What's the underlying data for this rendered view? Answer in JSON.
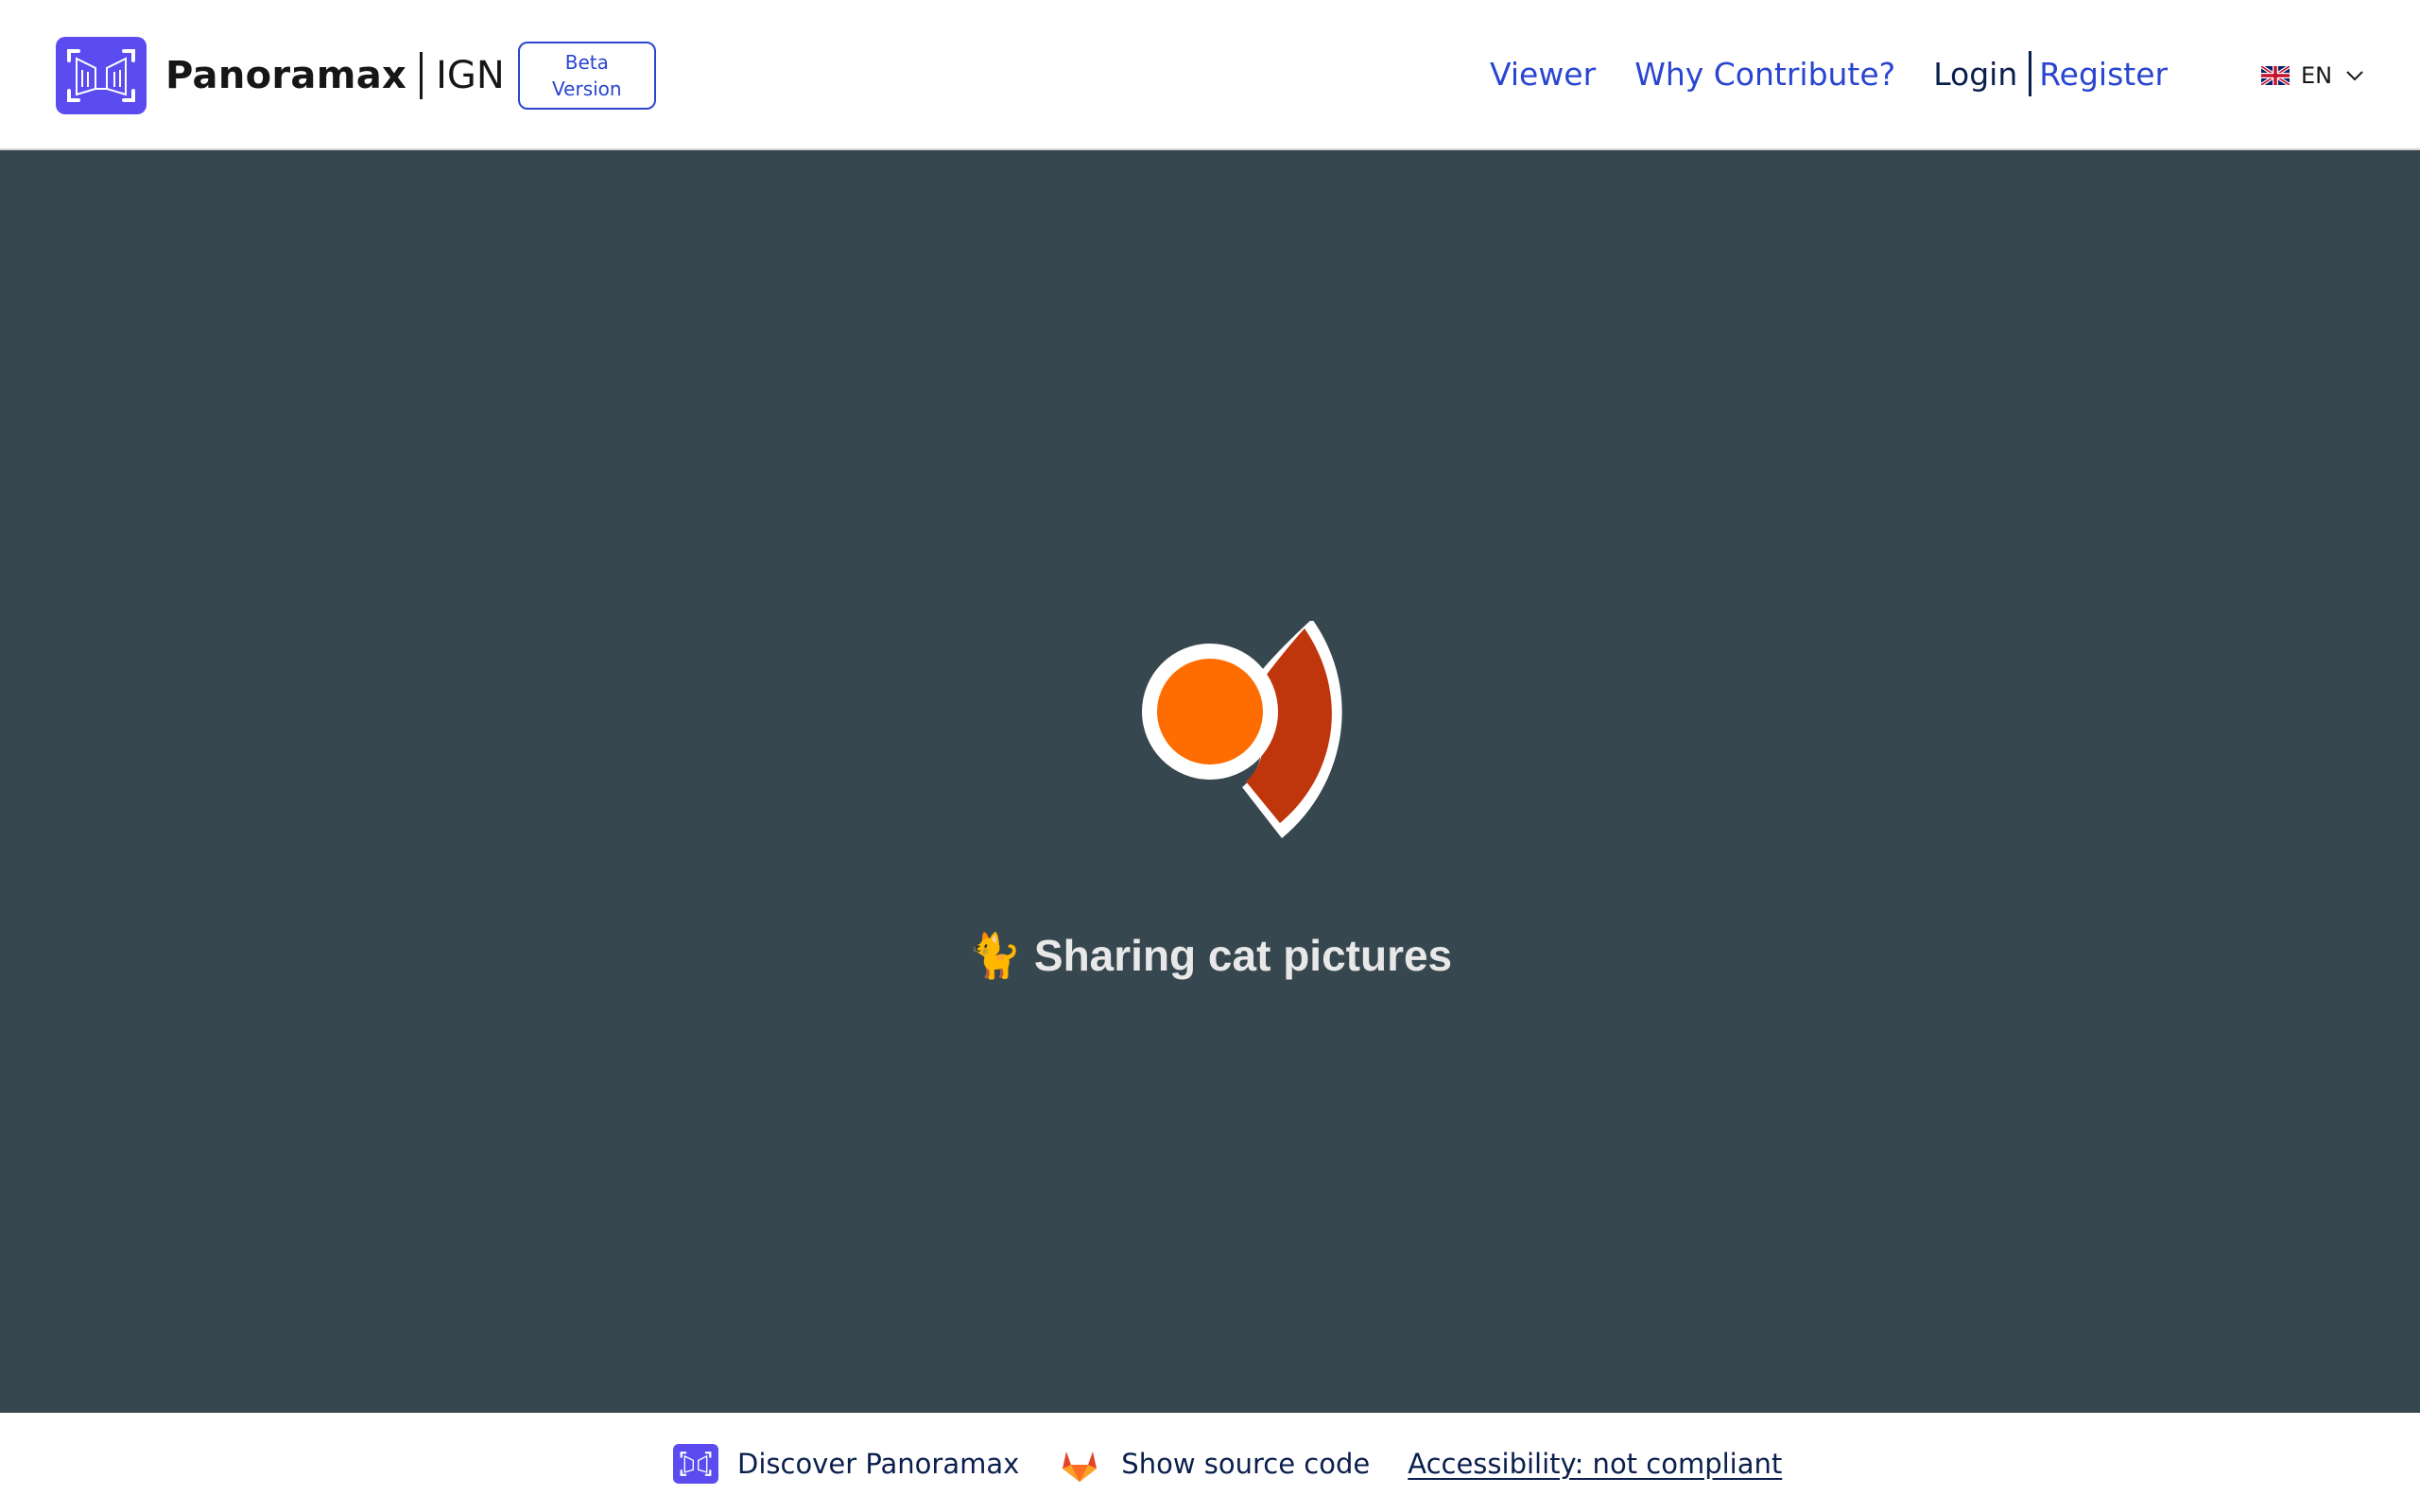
{
  "header": {
    "brand_name": "Panoramax",
    "brand_org": "IGN",
    "beta_line1": "Beta",
    "beta_line2": "Version",
    "nav": {
      "viewer": "Viewer",
      "why_contribute": "Why Contribute?",
      "login": "Login",
      "register": "Register"
    },
    "language": {
      "flag_icon": "uk-flag-icon",
      "selected": "EN"
    }
  },
  "main": {
    "background_color": "#37474f",
    "loading_emoji": "🐈",
    "loading_text": "Sharing cat pictures"
  },
  "footer": {
    "discover_label": "Discover Panoramax",
    "source_label": "Show source code",
    "accessibility_label": "Accessibility: not compliant"
  },
  "colors": {
    "brand": "#5b4cf0",
    "link": "#2a45cf",
    "dark_text": "#0b1f4d",
    "orange": "#ff6d00",
    "red": "#bf360c"
  }
}
